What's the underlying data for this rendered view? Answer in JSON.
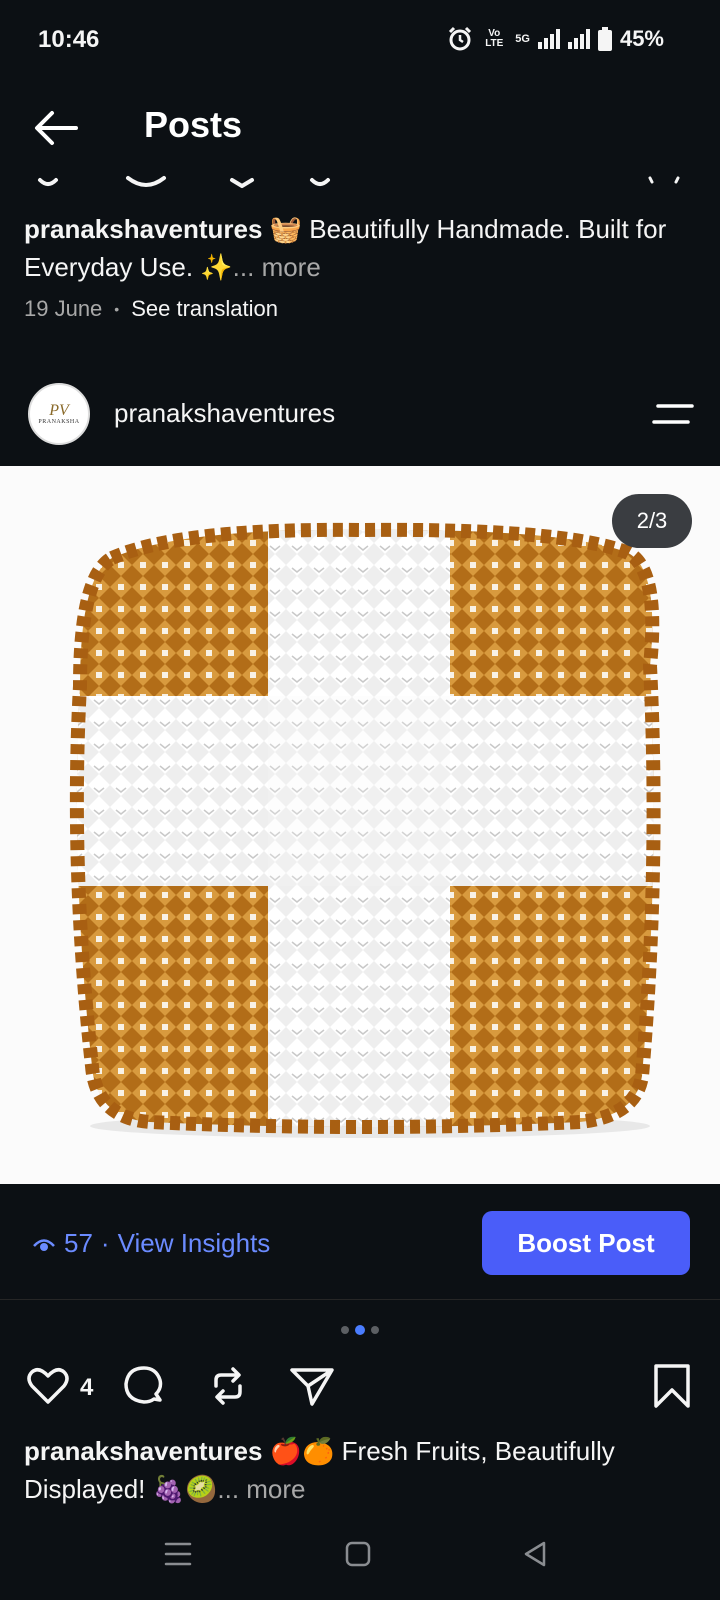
{
  "status_bar": {
    "time": "10:46",
    "volte": "Vo LTE",
    "network": "5G",
    "battery": "45%"
  },
  "header": {
    "title": "Posts",
    "back_icon": "arrow-left-icon"
  },
  "previous_post": {
    "username": "pranakshaventures",
    "caption": "🧺 Beautifully Handmade. Built for Everyday Use. ✨",
    "more": "... more",
    "date": "19 June",
    "separator": "•",
    "translate": "See translation"
  },
  "post": {
    "avatar_initials": "PV",
    "avatar_brand": "PRANAKSHA",
    "username": "pranakshaventures",
    "menu_icon": "menu-lines-icon",
    "image_counter": "2/3",
    "insights": {
      "icon": "eye-icon",
      "views": "57",
      "separator": " · ",
      "label": "View Insights"
    },
    "boost_label": "Boost Post",
    "carousel": {
      "total": 3,
      "active": 2
    },
    "likes": "4",
    "caption_username": "pranakshaventures",
    "caption": "🍎🍊 Fresh Fruits, Beautifully Displayed! 🍇🥝",
    "more": "... more"
  },
  "colors": {
    "background": "#0c1014",
    "accent": "#4a5df9",
    "link": "#6b8bff",
    "muted": "#a8a8a8",
    "basket_gold": "#b8731e",
    "basket_white": "#f4f4f4"
  }
}
